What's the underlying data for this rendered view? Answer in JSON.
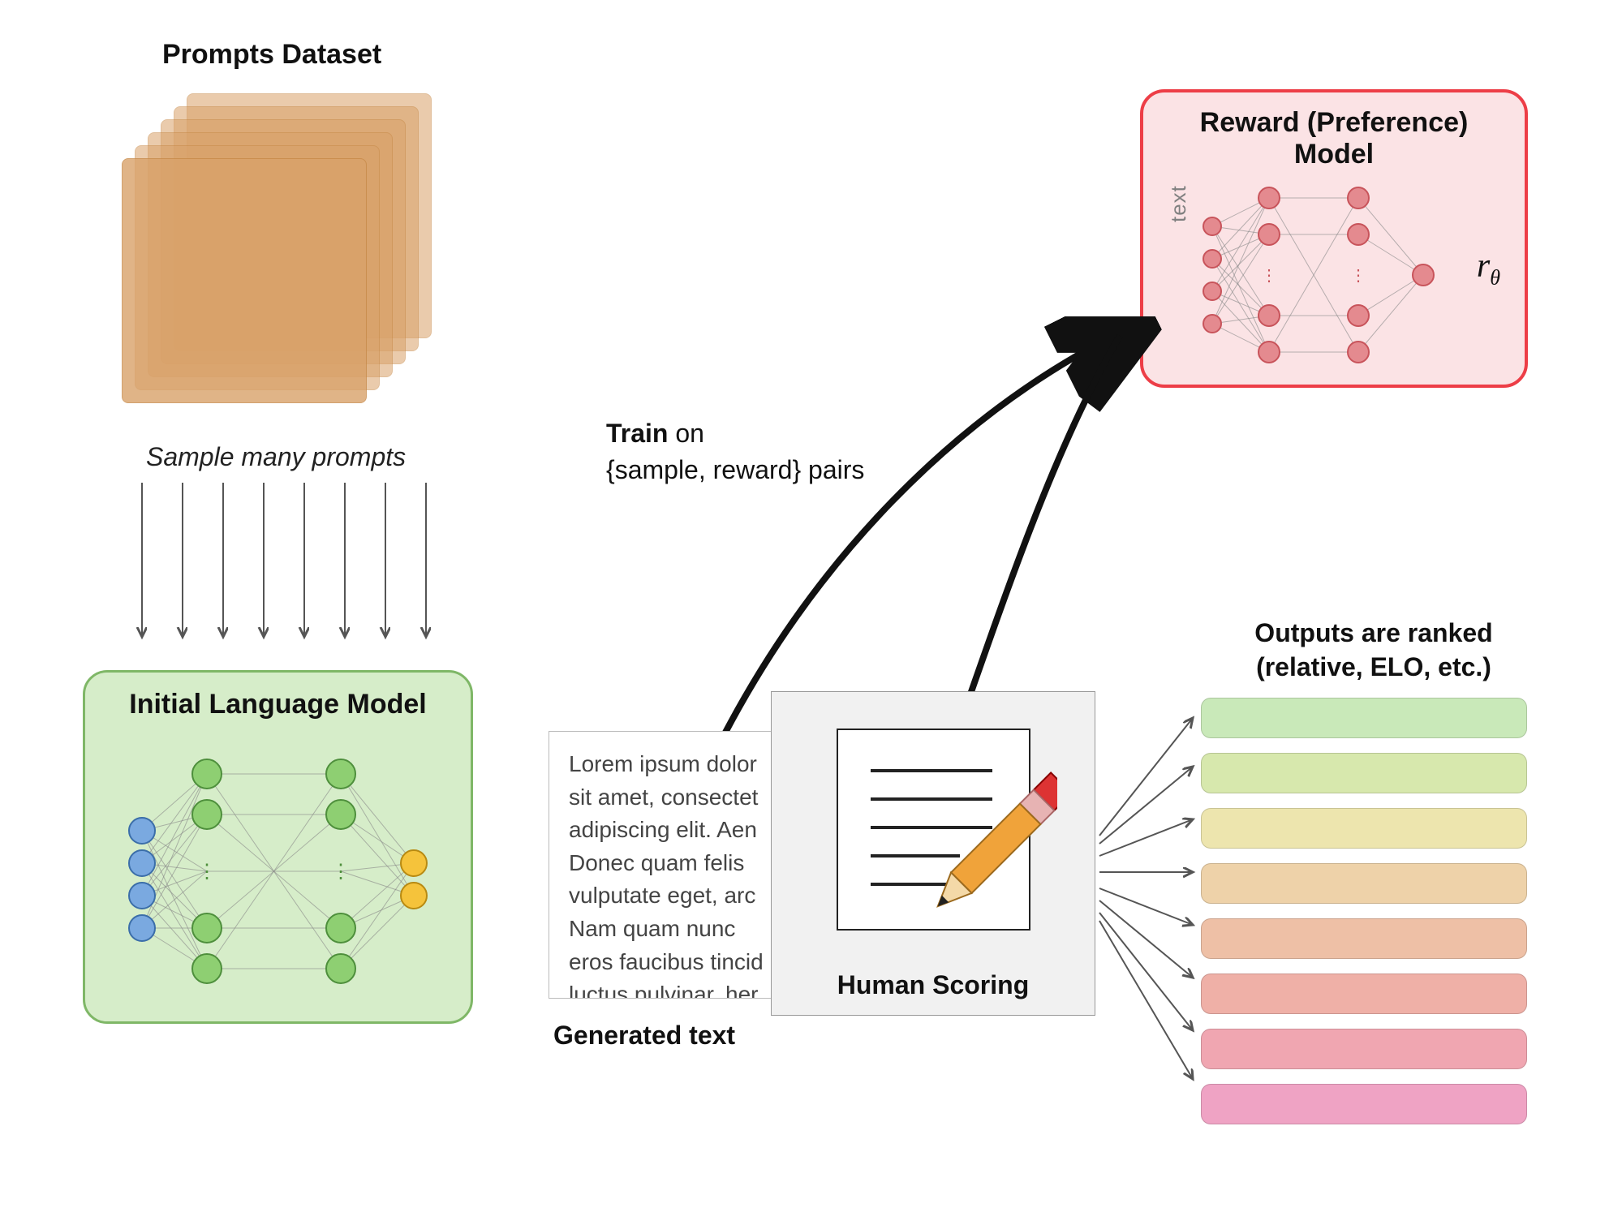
{
  "titles": {
    "prompts": "Prompts Dataset",
    "sample": "Sample many prompts",
    "ilm": "Initial Language Model",
    "reward": "Reward (Preference)\nModel",
    "reward_axis": "text",
    "reward_output": "r",
    "reward_sub": "θ",
    "train": "Train",
    "train_rest": " on\n{sample, reward} pairs",
    "generated": "Generated text",
    "human_scoring": "Human Scoring",
    "ranked": "Outputs are ranked\n(relative, ELO, etc.)"
  },
  "generated_lines": [
    "Lorem ipsum dolor",
    "sit amet, consectet",
    "adipiscing elit. Aen",
    "Donec quam felis",
    "vulputate eget, arc",
    "Nam quam nunc",
    "eros faucibus tincid",
    "luctus pulvinar, her"
  ],
  "rank_colors": [
    "#c9e9b9",
    "#d7e8ad",
    "#ede5ae",
    "#eed2a9",
    "#eec0a6",
    "#efb0a7",
    "#f0a6b1",
    "#efa3c4"
  ]
}
